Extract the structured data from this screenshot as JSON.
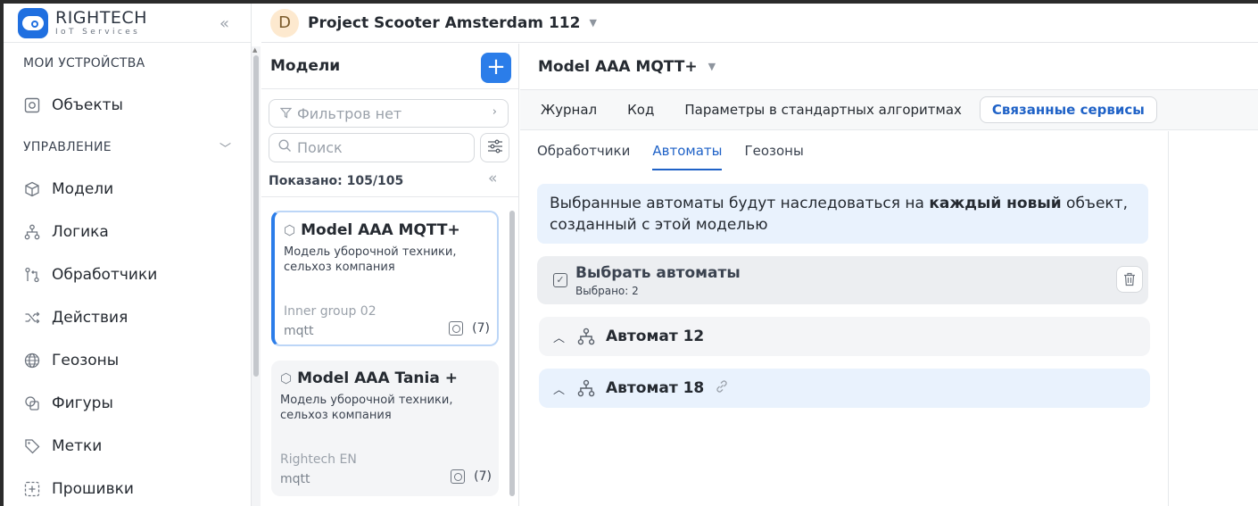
{
  "brand": {
    "title": "RIGHTECH",
    "subtitle": "IoT Services"
  },
  "sidebar": {
    "section_devices": "МОИ УСТРОЙСТВА",
    "section_manage": "УПРАВЛЕНИЕ",
    "items": [
      {
        "label": "Объекты",
        "icon": "object-icon"
      },
      {
        "label": "Модели",
        "icon": "cube-icon"
      },
      {
        "label": "Логика",
        "icon": "logic-tree-icon"
      },
      {
        "label": "Обработчики",
        "icon": "handler-icon"
      },
      {
        "label": "Действия",
        "icon": "shuffle-icon"
      },
      {
        "label": "Геозоны",
        "icon": "globe-icon"
      },
      {
        "label": "Фигуры",
        "icon": "shapes-icon"
      },
      {
        "label": "Метки",
        "icon": "tag-icon"
      },
      {
        "label": "Прошивки",
        "icon": "firmware-icon"
      }
    ]
  },
  "topbar": {
    "avatar_letter": "D",
    "project": "Project Scooter Amsterdam 112"
  },
  "models_panel": {
    "title": "Модели",
    "add_label": "+",
    "filter_placeholder": "Фильтров нет",
    "search_placeholder": "Поиск",
    "shown": "Показано: 105/105",
    "cards": [
      {
        "title": "Model AAA MQTT+",
        "desc": "Модель уборочной техники, сельхоз компания",
        "group": "Inner group 02",
        "protocol": "mqtt",
        "count": "(7)"
      },
      {
        "title": "Model AAA Tania +",
        "desc": "Модель уборочной техники, сельхоз компания",
        "group": "Rightech EN",
        "protocol": "mqtt",
        "count": "(7)"
      }
    ]
  },
  "main": {
    "title": "Model AAA MQTT+",
    "tabs": [
      "Журнал",
      "Код",
      "Параметры в стандартных алгоритмах",
      "Связанные сервисы"
    ],
    "subtabs": [
      "Обработчики",
      "Автоматы",
      "Геозоны"
    ],
    "info_part1": "Выбранные автоматы будут наследоваться на ",
    "info_bold": "каждый новый",
    "info_part2": " объект, созданный с этой моделью",
    "pick_title": "Выбрать автоматы",
    "pick_sub": "Выбрано: 2",
    "automata": [
      {
        "label": "Автомат 12"
      },
      {
        "label": "Автомат 18"
      }
    ]
  }
}
